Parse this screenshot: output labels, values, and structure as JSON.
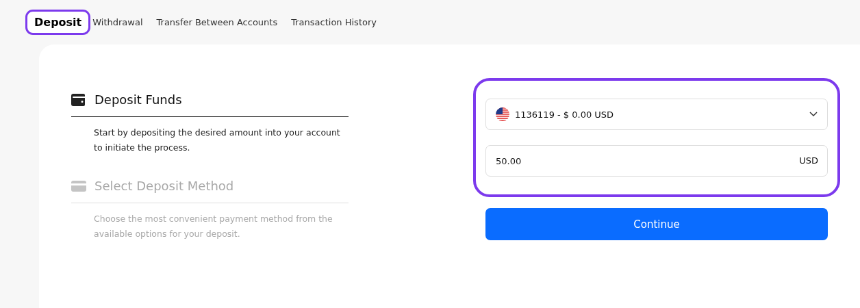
{
  "tabs": [
    {
      "label": "Deposit",
      "selected": true,
      "highlighted": true
    },
    {
      "label": "Withdrawal",
      "selected": false,
      "highlighted": false
    },
    {
      "label": "Transfer Between Accounts",
      "selected": false,
      "highlighted": false
    },
    {
      "label": "Transaction History",
      "selected": false,
      "highlighted": false
    }
  ],
  "steps": [
    {
      "kind": "wallet",
      "title": "Deposit Funds",
      "description": "Start by depositing the desired amount into your account to initiate the process.",
      "disabled": false
    },
    {
      "kind": "card",
      "title": "Select Deposit Method",
      "description": "Choose the most convenient payment method from the available options for your deposit.",
      "disabled": true
    }
  ],
  "form": {
    "highlighted": true,
    "account": {
      "value": "1136119 - $ 0.00 USD"
    },
    "amount": {
      "value": "50.00",
      "currency": "USD"
    },
    "submit": "Continue"
  }
}
